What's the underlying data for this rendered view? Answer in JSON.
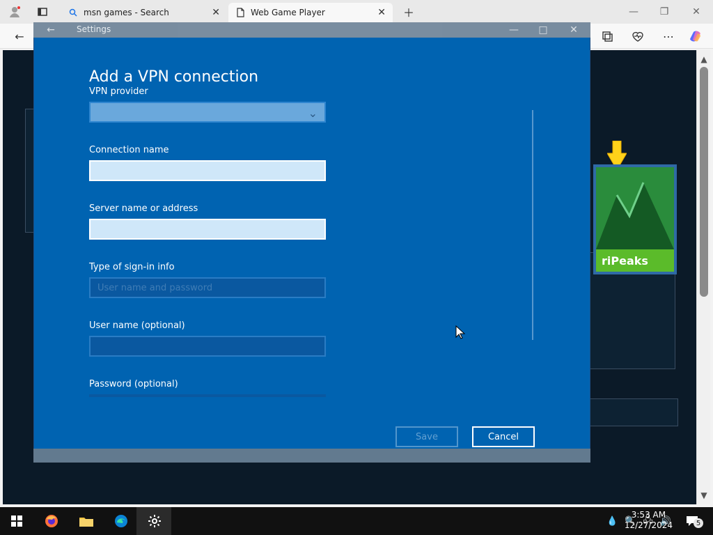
{
  "browser": {
    "tabs": [
      {
        "label": "msn games - Search"
      },
      {
        "label": "Web Game Player"
      }
    ]
  },
  "game": {
    "tile_label": "riPeaks"
  },
  "dialog": {
    "window_title": "Settings",
    "heading": "Add a VPN connection",
    "fields": {
      "vpn_provider": {
        "label": "VPN provider",
        "value": ""
      },
      "connection_name": {
        "label": "Connection name",
        "value": ""
      },
      "server": {
        "label": "Server name or address",
        "value": ""
      },
      "signin_type": {
        "label": "Type of sign-in info",
        "value": "User name and password"
      },
      "username": {
        "label": "User name (optional)",
        "value": ""
      },
      "password": {
        "label": "Password (optional)",
        "value": ""
      }
    },
    "buttons": {
      "save": "Save",
      "cancel": "Cancel"
    }
  },
  "taskbar": {
    "time": "3:53 AM",
    "date": "12/27/2024",
    "notifications": "5"
  }
}
